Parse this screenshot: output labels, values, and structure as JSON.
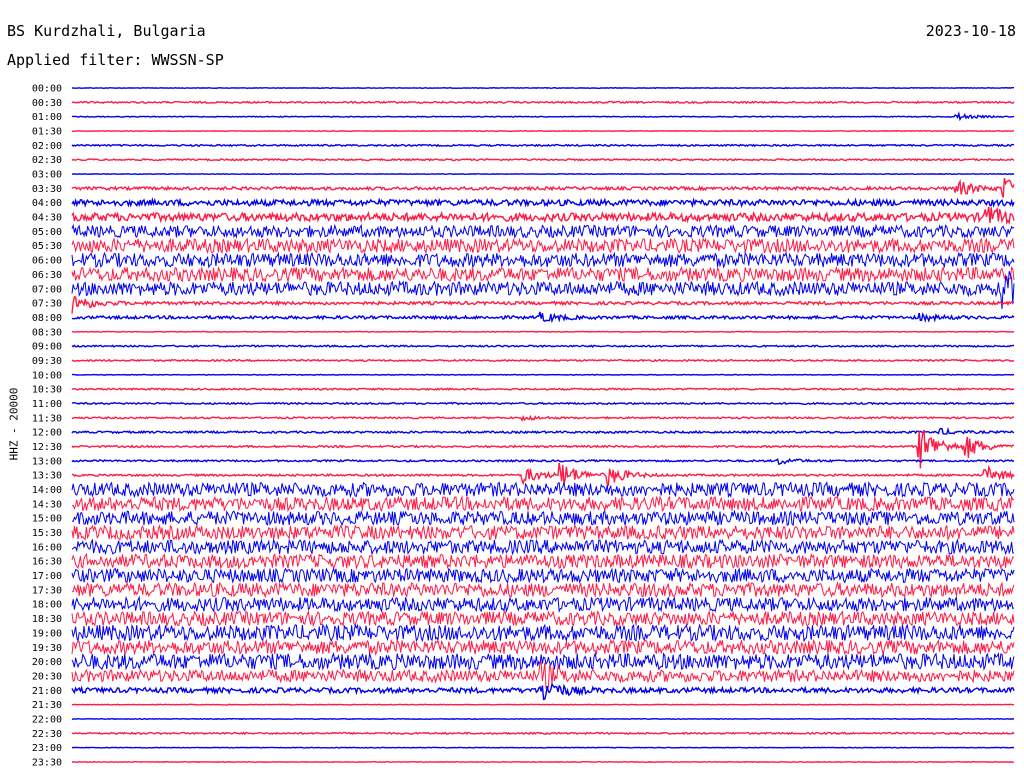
{
  "header": {
    "station": "BS Kurdzhali, Bulgaria",
    "filter": "Applied filter: WWSSN-SP",
    "date": "2023-10-18"
  },
  "colors": {
    "blue": "#0000ee",
    "red": "#ff1a44"
  },
  "chart_data": {
    "type": "line",
    "title": "BS Kurdzhali, Bulgaria",
    "subtitle": "Applied filter: WWSSN-SP",
    "date": "2023-10-18",
    "ylabel": "HHZ - 20000",
    "xlabel": "",
    "grid": false,
    "traces": [
      {
        "label": "00:00",
        "noise": 0.3,
        "color": "blue"
      },
      {
        "label": "00:30",
        "noise": 0.8,
        "color": "red"
      },
      {
        "label": "01:00",
        "noise": 0.4,
        "color": "blue",
        "events": [
          {
            "t": 0.94,
            "a": 3
          }
        ]
      },
      {
        "label": "01:30",
        "noise": 0.3,
        "color": "red"
      },
      {
        "label": "02:00",
        "noise": 0.8,
        "color": "blue"
      },
      {
        "label": "02:30",
        "noise": 0.8,
        "color": "red"
      },
      {
        "label": "03:00",
        "noise": 0.3,
        "color": "blue"
      },
      {
        "label": "03:30",
        "noise": 1.5,
        "color": "red",
        "events": [
          {
            "t": 0.94,
            "a": 7
          },
          {
            "t": 0.99,
            "a": 10
          }
        ]
      },
      {
        "label": "04:00",
        "noise": 3,
        "color": "blue"
      },
      {
        "label": "04:30",
        "noise": 4,
        "color": "red",
        "events": [
          {
            "t": 0.97,
            "a": 9
          }
        ]
      },
      {
        "label": "05:00",
        "noise": 6,
        "color": "blue"
      },
      {
        "label": "05:30",
        "noise": 7,
        "color": "red"
      },
      {
        "label": "06:00",
        "noise": 7,
        "color": "blue"
      },
      {
        "label": "06:30",
        "noise": 7,
        "color": "red"
      },
      {
        "label": "07:00",
        "noise": 7,
        "color": "blue",
        "events": [
          {
            "t": 0.99,
            "a": 14
          }
        ]
      },
      {
        "label": "07:30",
        "noise": 1.5,
        "color": "red",
        "events": [
          {
            "t": 0.0,
            "a": 10
          }
        ]
      },
      {
        "label": "08:00",
        "noise": 1.5,
        "color": "blue",
        "events": [
          {
            "t": 0.5,
            "a": 4
          },
          {
            "t": 0.9,
            "a": 3
          }
        ]
      },
      {
        "label": "08:30",
        "noise": 0.3,
        "color": "red"
      },
      {
        "label": "09:00",
        "noise": 0.8,
        "color": "blue"
      },
      {
        "label": "09:30",
        "noise": 0.8,
        "color": "red"
      },
      {
        "label": "10:00",
        "noise": 0.3,
        "color": "blue"
      },
      {
        "label": "10:30",
        "noise": 0.8,
        "color": "red"
      },
      {
        "label": "11:00",
        "noise": 0.8,
        "color": "blue"
      },
      {
        "label": "11:30",
        "noise": 0.8,
        "color": "red",
        "events": [
          {
            "t": 0.48,
            "a": 2
          }
        ]
      },
      {
        "label": "12:00",
        "noise": 1,
        "color": "blue",
        "events": [
          {
            "t": 0.92,
            "a": 3
          }
        ]
      },
      {
        "label": "12:30",
        "noise": 0.9,
        "color": "red",
        "events": [
          {
            "t": 0.9,
            "a": 22
          },
          {
            "t": 0.95,
            "a": 10
          }
        ]
      },
      {
        "label": "13:00",
        "noise": 0.9,
        "color": "blue",
        "events": [
          {
            "t": 0.75,
            "a": 3
          }
        ]
      },
      {
        "label": "13:30",
        "noise": 1,
        "color": "red",
        "events": [
          {
            "t": 0.48,
            "a": 8
          },
          {
            "t": 0.52,
            "a": 12
          },
          {
            "t": 0.57,
            "a": 9
          },
          {
            "t": 0.97,
            "a": 8
          }
        ]
      },
      {
        "label": "14:00",
        "noise": 7,
        "color": "blue"
      },
      {
        "label": "14:30",
        "noise": 7,
        "color": "red"
      },
      {
        "label": "15:00",
        "noise": 7,
        "color": "blue"
      },
      {
        "label": "15:30",
        "noise": 7,
        "color": "red"
      },
      {
        "label": "16:00",
        "noise": 7,
        "color": "blue"
      },
      {
        "label": "16:30",
        "noise": 7,
        "color": "red"
      },
      {
        "label": "17:00",
        "noise": 7,
        "color": "blue"
      },
      {
        "label": "17:30",
        "noise": 7,
        "color": "red"
      },
      {
        "label": "18:00",
        "noise": 7,
        "color": "blue"
      },
      {
        "label": "18:30",
        "noise": 7,
        "color": "red"
      },
      {
        "label": "19:00",
        "noise": 8,
        "color": "blue"
      },
      {
        "label": "19:30",
        "noise": 7,
        "color": "red"
      },
      {
        "label": "20:00",
        "noise": 8,
        "color": "blue"
      },
      {
        "label": "20:30",
        "noise": 6,
        "color": "red",
        "events": [
          {
            "t": 0.5,
            "a": 9
          }
        ]
      },
      {
        "label": "21:00",
        "noise": 2.5,
        "color": "blue",
        "events": [
          {
            "t": 0.5,
            "a": 12
          }
        ]
      },
      {
        "label": "21:30",
        "noise": 0.3,
        "color": "red"
      },
      {
        "label": "22:00",
        "noise": 0.3,
        "color": "blue"
      },
      {
        "label": "22:30",
        "noise": 0.8,
        "color": "red"
      },
      {
        "label": "23:00",
        "noise": 0.3,
        "color": "blue"
      },
      {
        "label": "23:30",
        "noise": 0.3,
        "color": "red"
      }
    ]
  }
}
